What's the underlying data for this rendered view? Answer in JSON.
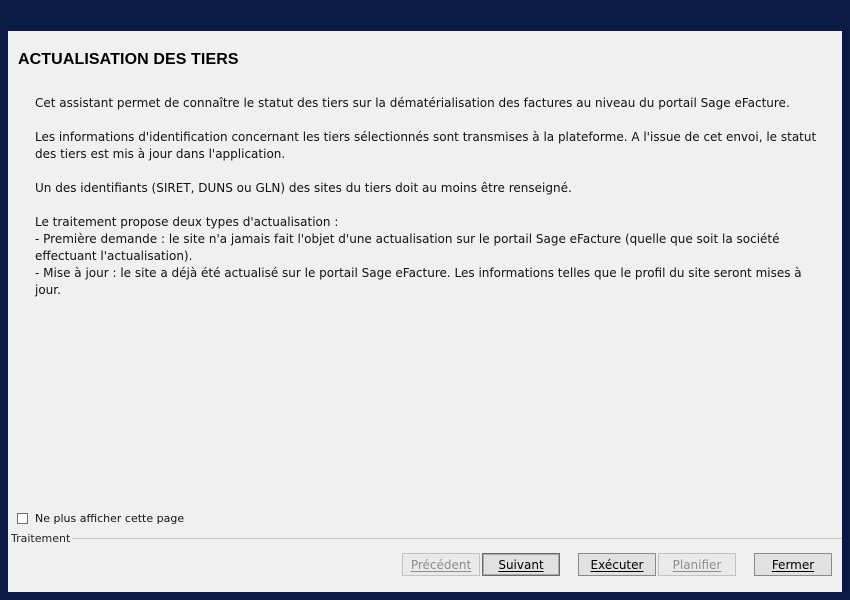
{
  "dialog": {
    "title": "ACTUALISATION DES TIERS",
    "paragraphs": [
      "Cet assistant permet de connaître le statut des tiers sur la dématérialisation des factures au niveau du portail Sage eFacture.",
      "Les informations d'identification concernant les tiers sélectionnés sont transmises à la plateforme. A l'issue de cet envoi, le statut des tiers est mis à jour dans l'application.",
      "Un des identifiants (SIRET, DUNS ou GLN) des sites du tiers doit au moins être renseigné."
    ],
    "types_intro": "Le traitement propose deux types d'actualisation :",
    "type_first": "- Première demande : le site n'a jamais fait l'objet d'une actualisation sur le portail Sage eFacture (quelle que soit la société effectuant l'actualisation).",
    "type_update": "- Mise à jour : le site a déjà été actualisé sur le portail Sage eFacture. Les informations telles que le profil du site seront mises à jour.",
    "checkbox_label": "Ne plus afficher cette page",
    "checkbox_checked": false,
    "group_label": "Traitement"
  },
  "buttons": {
    "previous": "Précédent",
    "next": "Suivant",
    "execute": "Exécuter",
    "schedule": "Planifier",
    "close": "Fermer"
  }
}
